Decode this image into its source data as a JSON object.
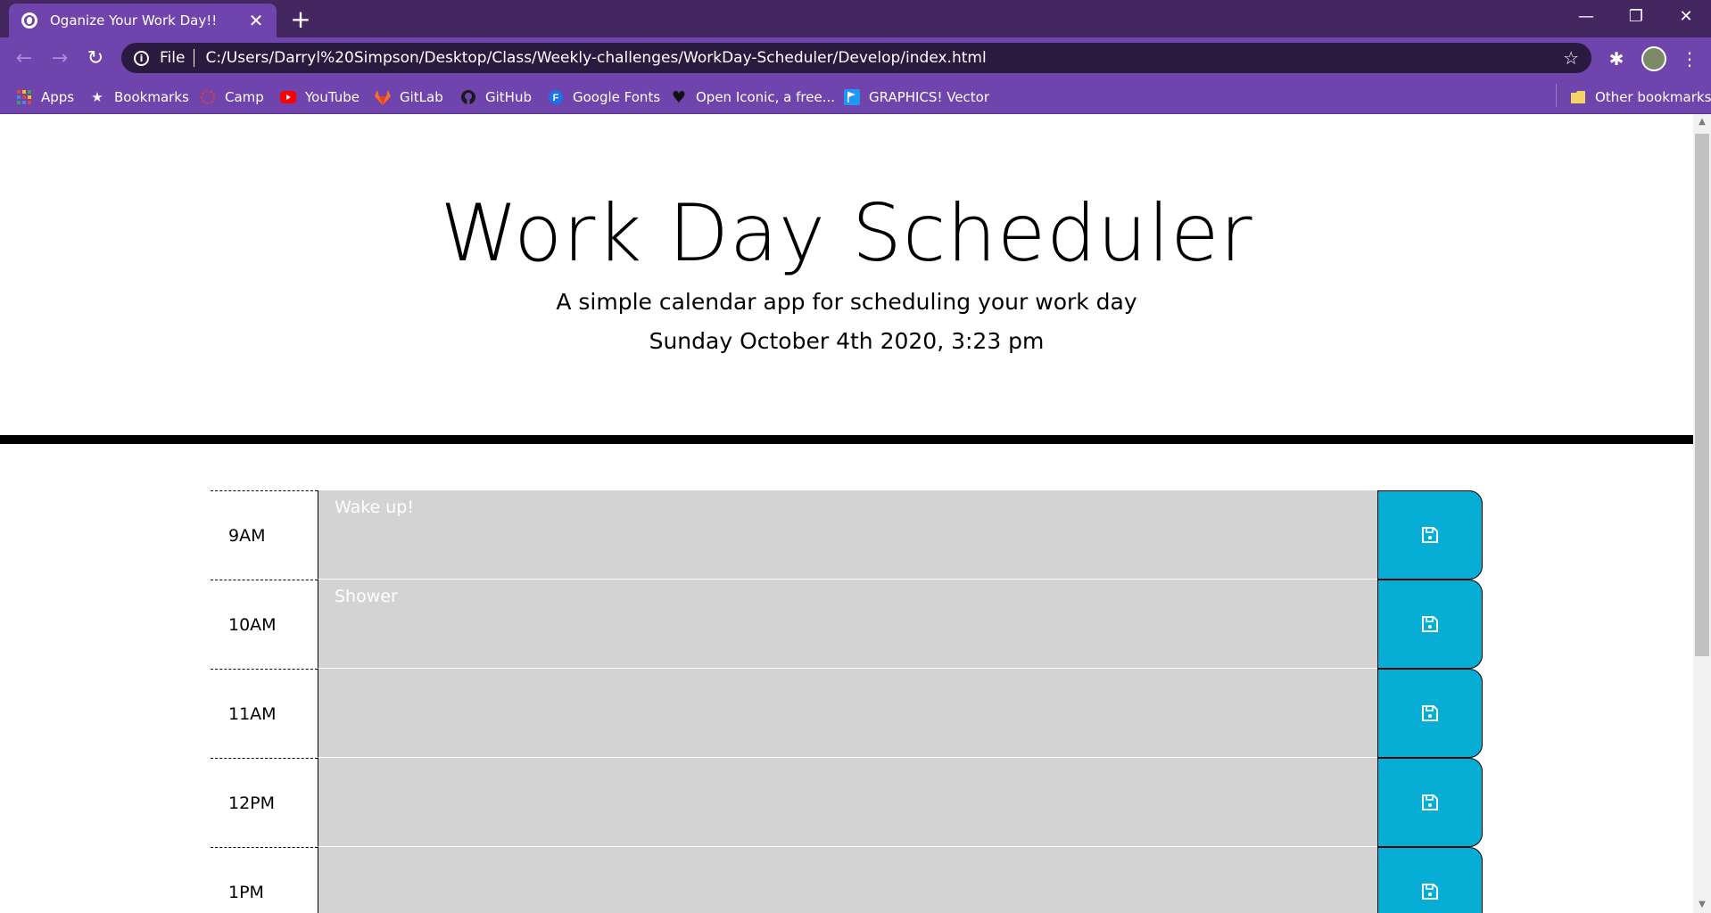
{
  "browser": {
    "tab_title": "Oganize Your Work Day!!",
    "tab_close": "✕",
    "new_tab": "+",
    "window_controls": {
      "minimize": "—",
      "restore": "❐",
      "close": "✕"
    },
    "address": {
      "scheme_label": "File",
      "url": "C:/Users/Darryl%20Simpson/Desktop/Class/Weekly-challenges/WorkDay-Scheduler/Develop/index.html"
    },
    "bookmarks": [
      {
        "label": "Apps",
        "icon": "apps-grid-icon"
      },
      {
        "label": "Bookmarks",
        "icon": "star-icon"
      },
      {
        "label": "Camp",
        "icon": "camp-icon"
      },
      {
        "label": "YouTube",
        "icon": "youtube-icon"
      },
      {
        "label": "GitLab",
        "icon": "gitlab-icon"
      },
      {
        "label": "GitHub",
        "icon": "github-icon"
      },
      {
        "label": "Google Fonts",
        "icon": "google-fonts-icon"
      },
      {
        "label": "Open Iconic, a free...",
        "icon": "heart-icon"
      },
      {
        "label": "GRAPHICS! Vector",
        "icon": "flag-icon"
      }
    ],
    "other_bookmarks": "Other bookmarks"
  },
  "header": {
    "title": "Work Day Scheduler",
    "lead": "A simple calendar app for scheduling your work day",
    "current_day": "Sunday October 4th 2020, 3:23 pm"
  },
  "schedule": [
    {
      "hour": "9AM",
      "text": "Wake up!"
    },
    {
      "hour": "10AM",
      "text": "Shower"
    },
    {
      "hour": "11AM",
      "text": ""
    },
    {
      "hour": "12PM",
      "text": ""
    },
    {
      "hour": "1PM",
      "text": ""
    }
  ],
  "colors": {
    "chrome_dark": "#442760",
    "chrome": "#7044ad",
    "past_row": "#d3d3d3",
    "save_button": "#06aed5"
  }
}
